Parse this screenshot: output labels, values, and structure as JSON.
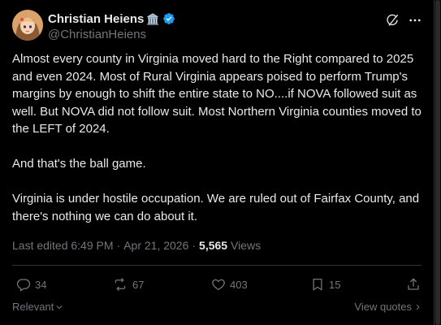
{
  "author": {
    "display_name": "Christian Heiens",
    "name_emoji": "🏛️",
    "handle": "@ChristianHeiens",
    "verified": true,
    "avatar_icon": "anime-avatar-icon"
  },
  "header_actions": {
    "grok_icon": "grok-icon",
    "more_icon": "more-dots-icon"
  },
  "post": {
    "paragraphs": [
      "Almost every county in Virginia moved hard to the Right compared to 2025 and even 2024. Most of Rural Virginia appears poised to perform Trump's margins by enough to shift the entire state to NO....if NOVA followed suit as well. But NOVA did not follow suit. Most Northern Virginia counties moved to the LEFT of 2024.",
      "And that's the ball game.",
      "Virginia is under hostile occupation. We are ruled out of Fairfax County, and there's nothing we can do about it."
    ]
  },
  "meta": {
    "edited": "Last edited 6:49 PM",
    "date": "Apr 21, 2026",
    "separator": "·",
    "views_count": "5,565",
    "views_label": "Views"
  },
  "actions": {
    "replies": "34",
    "reposts": "67",
    "likes": "403",
    "bookmarks": "15"
  },
  "footer": {
    "relevant_label": "Relevant",
    "view_quotes_label": "View quotes"
  },
  "colors": {
    "background": "#000000",
    "text": "#e7e9ea",
    "muted": "#71767b",
    "border": "#2f3336",
    "verified": "#1d9bf0"
  }
}
